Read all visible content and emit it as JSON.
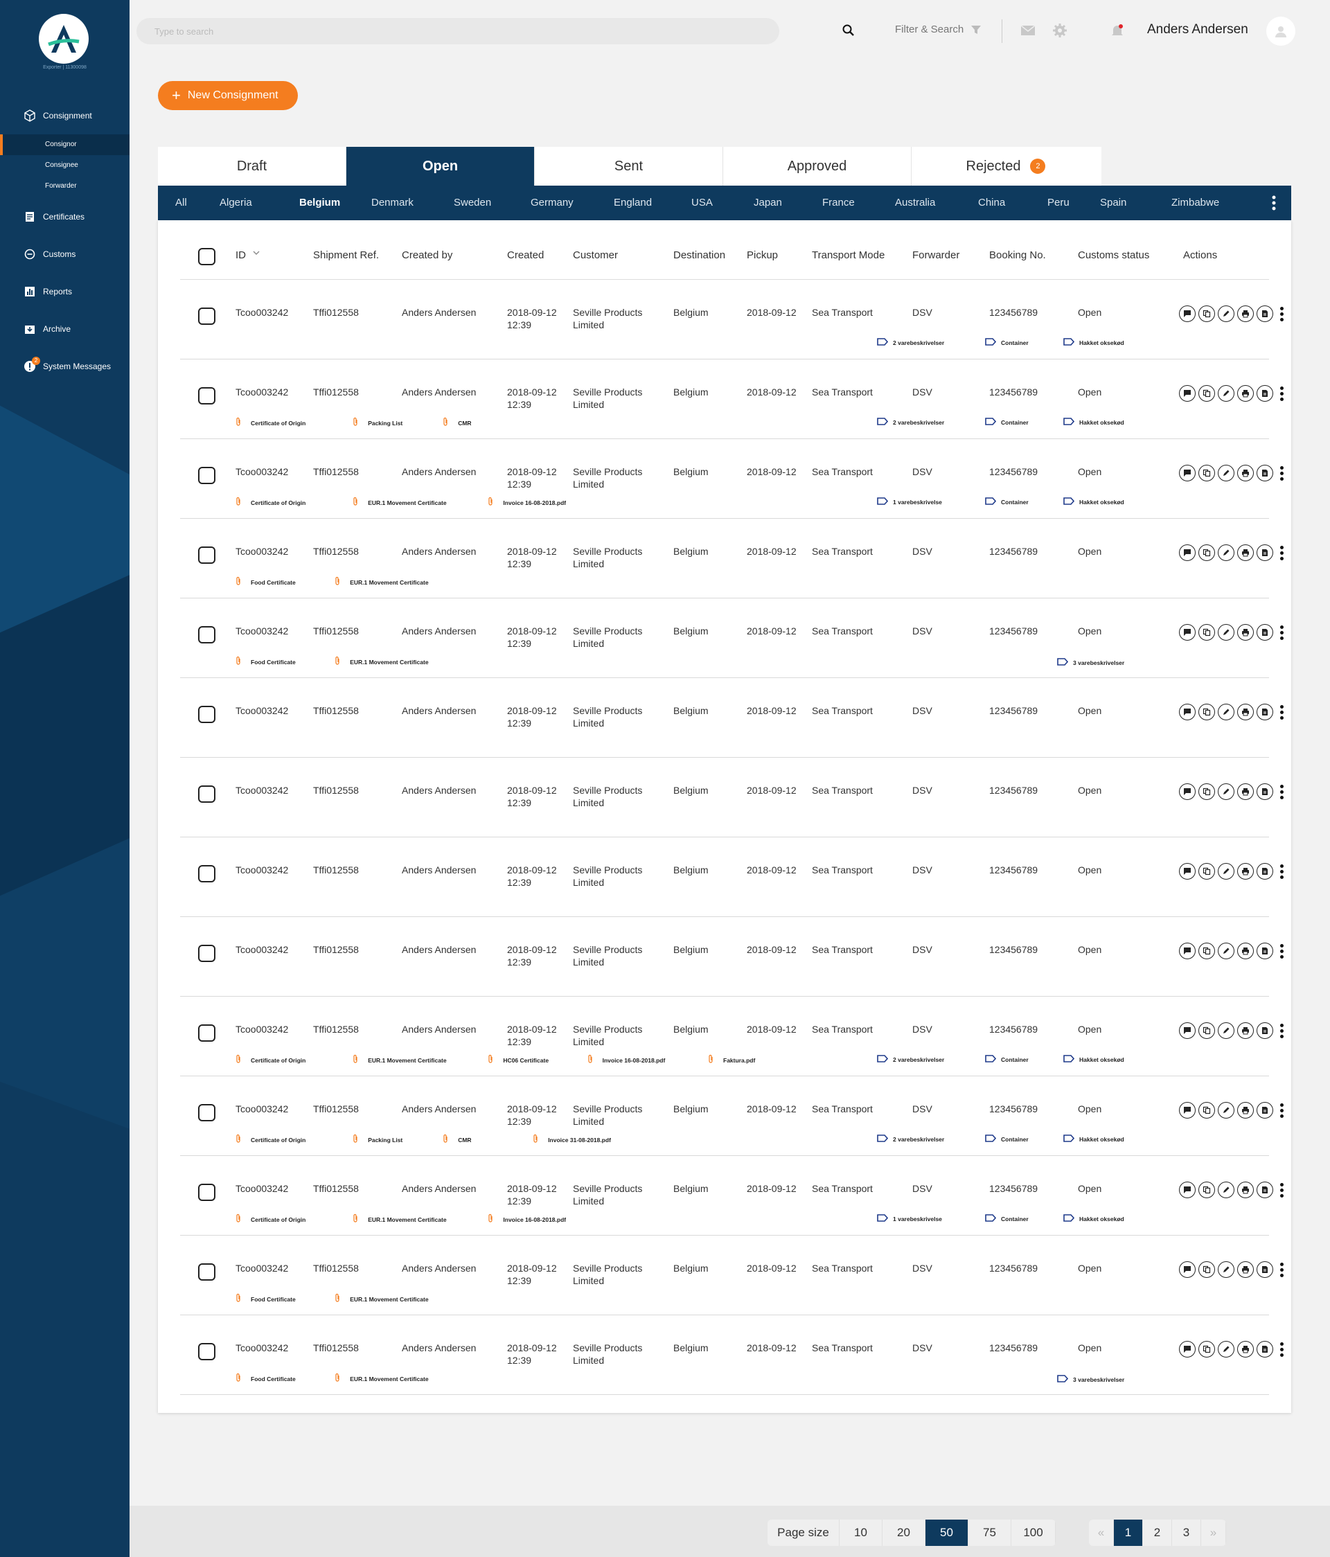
{
  "app": {
    "logo_subtitle": "Exporter | 11300098"
  },
  "sidebar": {
    "items": [
      {
        "label": "Consignment",
        "icon": "box-icon"
      },
      {
        "label": "Certificates",
        "icon": "certificate-icon"
      },
      {
        "label": "Customs",
        "icon": "minus-circle-icon"
      },
      {
        "label": "Reports",
        "icon": "chart-icon"
      },
      {
        "label": "Archive",
        "icon": "archive-icon"
      },
      {
        "label": "System Messages",
        "icon": "alert-icon",
        "badge": "2"
      }
    ],
    "sub_items": [
      "Consignor",
      "Consignee",
      "Forwarder"
    ],
    "active_sub": "Consignor"
  },
  "header": {
    "search_placeholder": "Type to search",
    "filter_label": "Filter & Search",
    "username": "Anders Andersen"
  },
  "new_button": "New Consignment",
  "tabs": [
    {
      "label": "Draft"
    },
    {
      "label": "Open",
      "active": true
    },
    {
      "label": "Sent"
    },
    {
      "label": "Approved"
    },
    {
      "label": "Rejected",
      "badge": "2"
    }
  ],
  "countries": [
    "All",
    "Algeria",
    "Belgium",
    "Denmark",
    "Sweden",
    "Germany",
    "England",
    "USA",
    "Japan",
    "France",
    "Australia",
    "China",
    "Peru",
    "Spain",
    "Zimbabwe"
  ],
  "active_country": "Belgium",
  "columns": [
    "ID",
    "Shipment Ref.",
    "Created by",
    "Created",
    "Customer",
    "Destination",
    "Pickup",
    "Transport Mode",
    "Forwarder",
    "Booking No.",
    "Customs status",
    "Actions"
  ],
  "rows": [
    {
      "id": "Tcoo003242",
      "ref": "Tffi012558",
      "by": "Anders Andersen",
      "date": "2018-09-12",
      "time": "12:39",
      "cust1": "Seville Products",
      "cust2": "Limited",
      "dest": "Belgium",
      "pickup": "2018-09-12",
      "mode": "Sea Transport",
      "fwd": "DSV",
      "booking": "123456789",
      "status": "Open",
      "attachments": [],
      "tags": [
        "2 varebeskrivelser",
        "Container",
        "Hakket oksekød"
      ]
    },
    {
      "id": "Tcoo003242",
      "ref": "Tffi012558",
      "by": "Anders Andersen",
      "date": "2018-09-12",
      "time": "12:39",
      "cust1": "Seville Products",
      "cust2": "Limited",
      "dest": "Belgium",
      "pickup": "2018-09-12",
      "mode": "Sea Transport",
      "fwd": "DSV",
      "booking": "123456789",
      "status": "Open",
      "attachments": [
        "Certificate of Origin",
        "Packing List",
        "CMR"
      ],
      "tags": [
        "2 varebeskrivelser",
        "Container",
        "Hakket oksekød"
      ]
    },
    {
      "id": "Tcoo003242",
      "ref": "Tffi012558",
      "by": "Anders Andersen",
      "date": "2018-09-12",
      "time": "12:39",
      "cust1": "Seville Products",
      "cust2": "Limited",
      "dest": "Belgium",
      "pickup": "2018-09-12",
      "mode": "Sea Transport",
      "fwd": "DSV",
      "booking": "123456789",
      "status": "Open",
      "attachments": [
        "Certificate of Origin",
        "EUR.1 Movement Certificate",
        "Invoice 16-08-2018.pdf"
      ],
      "tags": [
        "1 varebeskrivelse",
        "Container",
        "Hakket oksekød"
      ]
    },
    {
      "id": "Tcoo003242",
      "ref": "Tffi012558",
      "by": "Anders Andersen",
      "date": "2018-09-12",
      "time": "12:39",
      "cust1": "Seville Products",
      "cust2": "Limited",
      "dest": "Belgium",
      "pickup": "2018-09-12",
      "mode": "Sea Transport",
      "fwd": "DSV",
      "booking": "123456789",
      "status": "Open",
      "attachments": [
        "Food Certificate",
        "EUR.1 Movement Certificate"
      ],
      "tags": []
    },
    {
      "id": "Tcoo003242",
      "ref": "Tffi012558",
      "by": "Anders Andersen",
      "date": "2018-09-12",
      "time": "12:39",
      "cust1": "Seville Products",
      "cust2": "Limited",
      "dest": "Belgium",
      "pickup": "2018-09-12",
      "mode": "Sea Transport",
      "fwd": "DSV",
      "booking": "123456789",
      "status": "Open",
      "attachments": [
        "Food Certificate",
        "EUR.1 Movement Certificate"
      ],
      "tags": [
        "3 varebeskrivelser"
      ]
    },
    {
      "id": "Tcoo003242",
      "ref": "Tffi012558",
      "by": "Anders Andersen",
      "date": "2018-09-12",
      "time": "12:39",
      "cust1": "Seville Products",
      "cust2": "Limited",
      "dest": "Belgium",
      "pickup": "2018-09-12",
      "mode": "Sea Transport",
      "fwd": "DSV",
      "booking": "123456789",
      "status": "Open",
      "attachments": [],
      "tags": []
    },
    {
      "id": "Tcoo003242",
      "ref": "Tffi012558",
      "by": "Anders Andersen",
      "date": "2018-09-12",
      "time": "12:39",
      "cust1": "Seville Products",
      "cust2": "Limited",
      "dest": "Belgium",
      "pickup": "2018-09-12",
      "mode": "Sea Transport",
      "fwd": "DSV",
      "booking": "123456789",
      "status": "Open",
      "attachments": [],
      "tags": []
    },
    {
      "id": "Tcoo003242",
      "ref": "Tffi012558",
      "by": "Anders Andersen",
      "date": "2018-09-12",
      "time": "12:39",
      "cust1": "Seville Products",
      "cust2": "Limited",
      "dest": "Belgium",
      "pickup": "2018-09-12",
      "mode": "Sea Transport",
      "fwd": "DSV",
      "booking": "123456789",
      "status": "Open",
      "attachments": [],
      "tags": []
    },
    {
      "id": "Tcoo003242",
      "ref": "Tffi012558",
      "by": "Anders Andersen",
      "date": "2018-09-12",
      "time": "12:39",
      "cust1": "Seville Products",
      "cust2": "Limited",
      "dest": "Belgium",
      "pickup": "2018-09-12",
      "mode": "Sea Transport",
      "fwd": "DSV",
      "booking": "123456789",
      "status": "Open",
      "attachments": [],
      "tags": []
    },
    {
      "id": "Tcoo003242",
      "ref": "Tffi012558",
      "by": "Anders Andersen",
      "date": "2018-09-12",
      "time": "12:39",
      "cust1": "Seville Products",
      "cust2": "Limited",
      "dest": "Belgium",
      "pickup": "2018-09-12",
      "mode": "Sea Transport",
      "fwd": "DSV",
      "booking": "123456789",
      "status": "Open",
      "attachments": [
        "Certificate of Origin",
        "EUR.1 Movement Certificate",
        "HC06 Certificate",
        "Invoice 16-08-2018.pdf",
        "Faktura.pdf"
      ],
      "tags": [
        "2 varebeskrivelser",
        "Container",
        "Hakket oksekød"
      ]
    },
    {
      "id": "Tcoo003242",
      "ref": "Tffi012558",
      "by": "Anders Andersen",
      "date": "2018-09-12",
      "time": "12:39",
      "cust1": "Seville Products",
      "cust2": "Limited",
      "dest": "Belgium",
      "pickup": "2018-09-12",
      "mode": "Sea Transport",
      "fwd": "DSV",
      "booking": "123456789",
      "status": "Open",
      "attachments": [
        "Certificate of Origin",
        "Packing List",
        "CMR",
        "Invoice 31-08-2018.pdf"
      ],
      "tags": [
        "2 varebeskrivelser",
        "Container",
        "Hakket oksekød"
      ]
    },
    {
      "id": "Tcoo003242",
      "ref": "Tffi012558",
      "by": "Anders Andersen",
      "date": "2018-09-12",
      "time": "12:39",
      "cust1": "Seville Products",
      "cust2": "Limited",
      "dest": "Belgium",
      "pickup": "2018-09-12",
      "mode": "Sea Transport",
      "fwd": "DSV",
      "booking": "123456789",
      "status": "Open",
      "attachments": [
        "Certificate of Origin",
        "EUR.1 Movement Certificate",
        "Invoice 16-08-2018.pdf"
      ],
      "tags": [
        "1 varebeskrivelse",
        "Container",
        "Hakket oksekød"
      ]
    },
    {
      "id": "Tcoo003242",
      "ref": "Tffi012558",
      "by": "Anders Andersen",
      "date": "2018-09-12",
      "time": "12:39",
      "cust1": "Seville Products",
      "cust2": "Limited",
      "dest": "Belgium",
      "pickup": "2018-09-12",
      "mode": "Sea Transport",
      "fwd": "DSV",
      "booking": "123456789",
      "status": "Open",
      "attachments": [
        "Food Certificate",
        "EUR.1 Movement Certificate"
      ],
      "tags": []
    },
    {
      "id": "Tcoo003242",
      "ref": "Tffi012558",
      "by": "Anders Andersen",
      "date": "2018-09-12",
      "time": "12:39",
      "cust1": "Seville Products",
      "cust2": "Limited",
      "dest": "Belgium",
      "pickup": "2018-09-12",
      "mode": "Sea Transport",
      "fwd": "DSV",
      "booking": "123456789",
      "status": "Open",
      "attachments": [
        "Food Certificate",
        "EUR.1 Movement Certificate"
      ],
      "tags": [
        "3 varebeskrivelser"
      ]
    }
  ],
  "footer": {
    "page_size_label": "Page size",
    "page_sizes": [
      "10",
      "20",
      "50",
      "75",
      "100"
    ],
    "active_page_size": "50",
    "pages": [
      "1",
      "2",
      "3"
    ],
    "active_page": "1",
    "prev_symbol": "«",
    "next_symbol": "»"
  },
  "colors": {
    "navy": "#0e3a5e",
    "orange": "#f47d1f",
    "tag_blue": "#1f3a8a"
  }
}
